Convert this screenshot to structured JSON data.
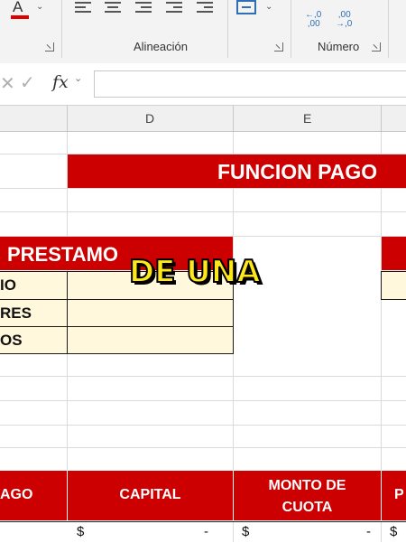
{
  "ribbon": {
    "font_color_letter": "A",
    "alignment_label": "Alineación",
    "number_label": "Número",
    "increase_decimal_icon_text": "←,0\n,00",
    "decrease_decimal_icon_text": ",00\n→,0"
  },
  "formula_bar": {
    "fx_label": "fx"
  },
  "columns": [
    "D",
    "E"
  ],
  "sheet": {
    "title": "FUNCION PAGO",
    "prestamo_header": "PRESTAMO",
    "row_labels": [
      "IO",
      "RES",
      "OS"
    ],
    "table_headers": {
      "col1": "AGO",
      "col2": "CAPITAL",
      "col3": "MONTO DE CUOTA",
      "col4": "P"
    },
    "currency_symbol": "$",
    "dash": "-"
  },
  "caption": "DE UNA",
  "colors": {
    "red": "#cc0000",
    "yellow_cell": "#fff8dc",
    "caption_fill": "#ffe81a"
  }
}
